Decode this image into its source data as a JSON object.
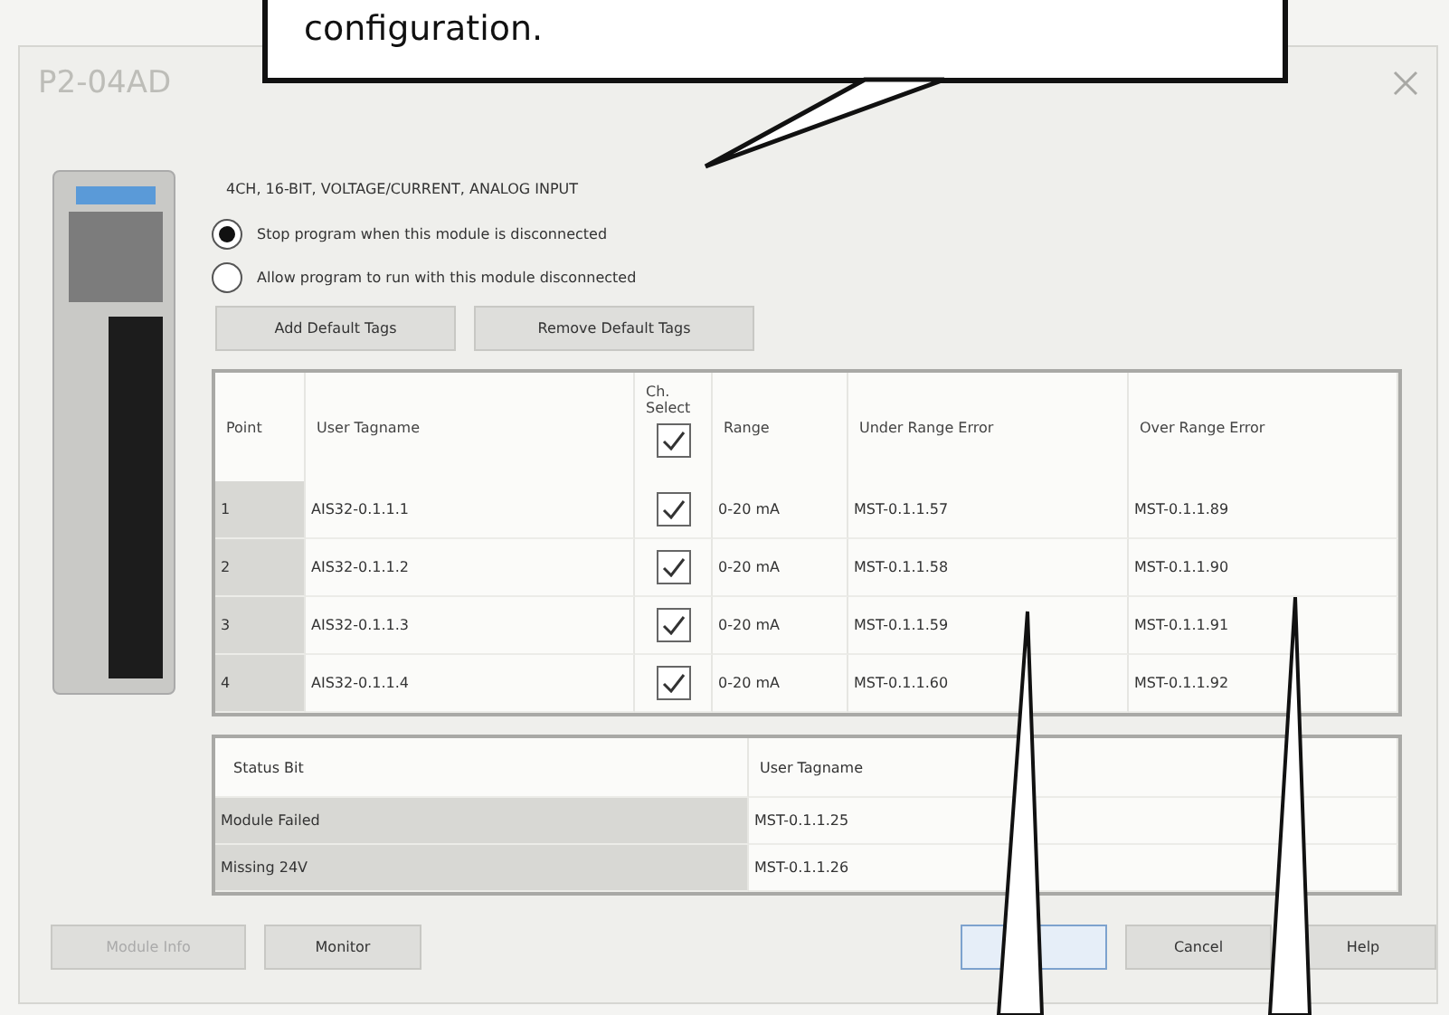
{
  "callout": {
    "text": "configuration."
  },
  "window": {
    "title": "P2-04AD"
  },
  "module": {
    "description": "4CH, 16-BIT, VOLTAGE/CURRENT, ANALOG INPUT"
  },
  "options": [
    {
      "label": "Stop program when this module is disconnected",
      "selected": true
    },
    {
      "label": "Allow program to run with this module disconnected",
      "selected": false
    }
  ],
  "tag_buttons": [
    "Add Default Tags",
    "Remove Default Tags"
  ],
  "channels": {
    "columns": [
      "Point",
      "User Tagname",
      "Ch. Select",
      "Range",
      "Under Range Error",
      "Over Range Error"
    ],
    "all_checked": true,
    "rows": [
      {
        "point": "1",
        "tagname": "AIS32-0.1.1.1",
        "checked": true,
        "range": "0-20 mA",
        "under": "MST-0.1.1.57",
        "over": "MST-0.1.1.89"
      },
      {
        "point": "2",
        "tagname": "AIS32-0.1.1.2",
        "checked": true,
        "range": "0-20 mA",
        "under": "MST-0.1.1.58",
        "over": "MST-0.1.1.90"
      },
      {
        "point": "3",
        "tagname": "AIS32-0.1.1.3",
        "checked": true,
        "range": "0-20 mA",
        "under": "MST-0.1.1.59",
        "over": "MST-0.1.1.91"
      },
      {
        "point": "4",
        "tagname": "AIS32-0.1.1.4",
        "checked": true,
        "range": "0-20 mA",
        "under": "MST-0.1.1.60",
        "over": "MST-0.1.1.92"
      }
    ]
  },
  "status_bits": {
    "columns": [
      "Status Bit",
      "User Tagname"
    ],
    "rows": [
      {
        "bit": "Module Failed",
        "tagname": "MST-0.1.1.25"
      },
      {
        "bit": "Missing 24V",
        "tagname": "MST-0.1.1.26"
      }
    ]
  },
  "footer_left": [
    {
      "label": "Module Info",
      "disabled": true
    },
    {
      "label": "Monitor",
      "disabled": false
    }
  ],
  "footer_right": [
    {
      "kind": "default"
    },
    {
      "label": "Cancel",
      "kind": "normal"
    },
    {
      "label": "Help",
      "kind": "normal"
    }
  ]
}
